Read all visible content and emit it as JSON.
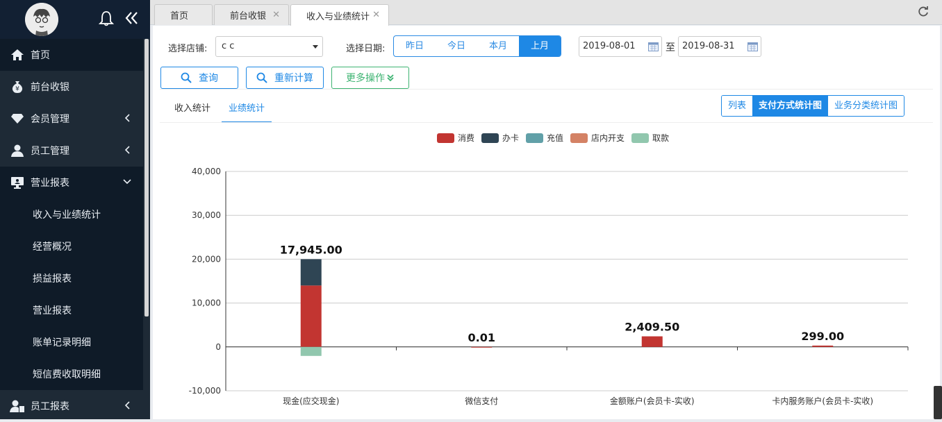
{
  "sidebar": {
    "items": [
      {
        "label": "首页",
        "icon": "home-icon"
      },
      {
        "label": "前台收银",
        "icon": "money-bag-icon"
      },
      {
        "label": "会员管理",
        "icon": "diamond-icon"
      },
      {
        "label": "员工管理",
        "icon": "user-icon"
      },
      {
        "label": "营业报表",
        "icon": "monitor-icon"
      },
      {
        "label": "员工报表",
        "icon": "user-report-icon"
      }
    ],
    "subitems": [
      "收入与业绩统计",
      "经营概况",
      "损益报表",
      "营业报表",
      "账单记录明细",
      "短信费收取明细"
    ]
  },
  "tabs": [
    "首页",
    "前台收银",
    "收入与业绩统计"
  ],
  "filters": {
    "store_label": "选择店铺:",
    "store_value": "c c",
    "date_label": "选择日期:",
    "ranges": [
      "昨日",
      "今日",
      "本月",
      "上月"
    ],
    "active_range": "上月",
    "date_from": "2019-08-01",
    "to_label": "至",
    "date_to": "2019-08-31"
  },
  "buttons": {
    "query": "查询",
    "recalc": "重新计算",
    "more": "更多操作"
  },
  "inner_tabs": [
    "收入统计",
    "业绩统计"
  ],
  "view_tabs": [
    "列表",
    "支付方式统计图",
    "业务分类统计图"
  ],
  "colors": {
    "accent": "#1e88e5",
    "green": "#3cb371",
    "sidebar": "#1e2a36"
  },
  "chart_data": {
    "type": "bar",
    "stacked": true,
    "categories": [
      "现金(应交现金)",
      "微信支付",
      "金额账户(会员卡-实收)",
      "卡内服务账户(会员卡-实收)"
    ],
    "series": [
      {
        "name": "消费",
        "color": "#c23531",
        "values": [
          14000,
          0.01,
          2409.5,
          299
        ]
      },
      {
        "name": "办卡",
        "color": "#2f4554",
        "values": [
          6000,
          0,
          0,
          0
        ]
      },
      {
        "name": "充值",
        "color": "#61a0a8",
        "values": [
          0,
          0,
          0,
          0
        ]
      },
      {
        "name": "店内开支",
        "color": "#d48265",
        "values": [
          0,
          0,
          0,
          0
        ]
      },
      {
        "name": "取款",
        "color": "#91c7ae",
        "values": [
          -2055,
          0,
          0,
          0
        ]
      }
    ],
    "totals": [
      "17,945.00",
      "0.01",
      "2,409.50",
      "299.00"
    ],
    "yticks": [
      "40,000",
      "30,000",
      "20,000",
      "10,000",
      "0",
      "-10,000"
    ],
    "ylim": [
      -10000,
      40000
    ],
    "legend_position": "top-center",
    "grid": true
  }
}
